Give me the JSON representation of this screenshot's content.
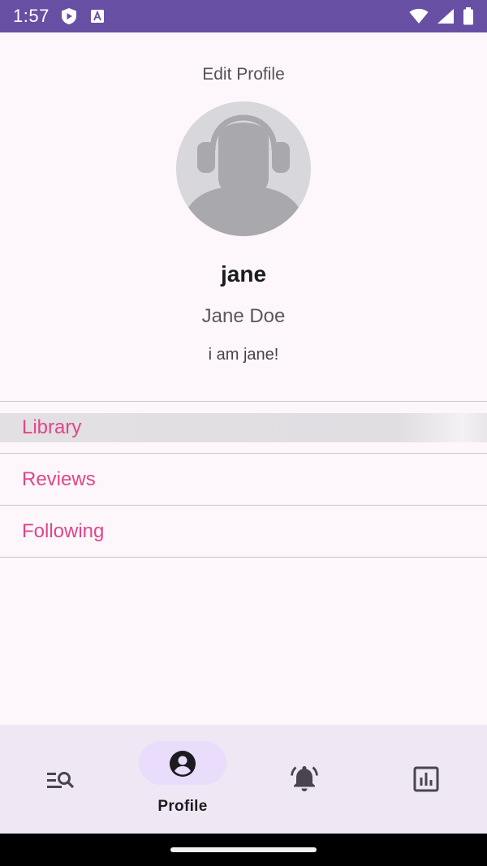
{
  "status_bar": {
    "time": "1:57",
    "icons": [
      "play-protect-icon",
      "text-recognition-icon",
      "wifi-icon",
      "signal-icon",
      "battery-icon"
    ]
  },
  "profile": {
    "edit_label": "Edit Profile",
    "username": "jane",
    "full_name": "Jane Doe",
    "bio": "i am jane!",
    "avatar_icon": "default-avatar-headphones-icon"
  },
  "menu": {
    "items": [
      {
        "label": "Library"
      },
      {
        "label": "Reviews"
      },
      {
        "label": "Following"
      }
    ]
  },
  "bottom_nav": {
    "items": [
      {
        "icon": "search-list-icon",
        "label": ""
      },
      {
        "icon": "account-circle-icon",
        "label": "Profile",
        "selected": true
      },
      {
        "icon": "notifications-active-icon",
        "label": ""
      },
      {
        "icon": "bar-chart-icon",
        "label": ""
      }
    ]
  },
  "colors": {
    "status_bar": "#6750a4",
    "background": "#fdf7fb",
    "menu_text": "#e0468a",
    "nav_background": "#efe8f4",
    "nav_active_pill": "#e9ddfb"
  }
}
